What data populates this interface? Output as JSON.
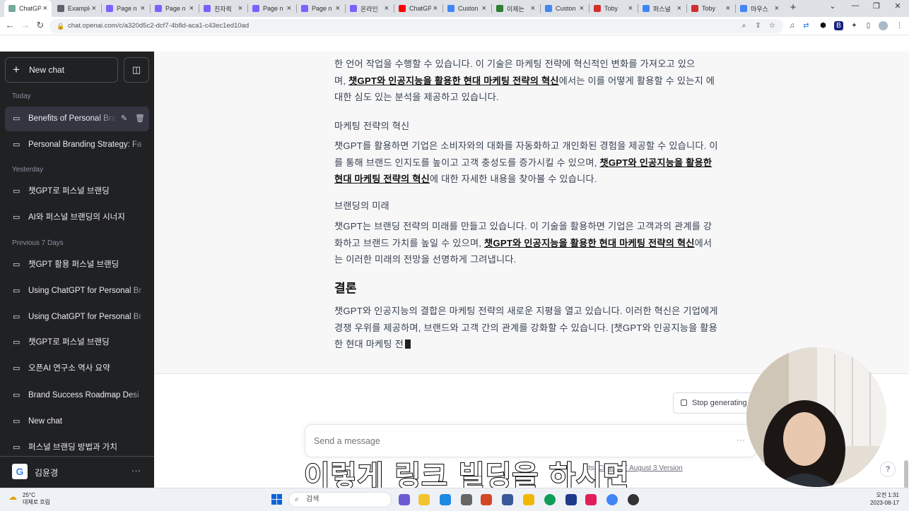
{
  "browser": {
    "tabs": [
      {
        "title": "ChatGPT",
        "color": "#74aa9c",
        "active": true
      },
      {
        "title": "Example",
        "color": "#5f6368"
      },
      {
        "title": "Page n",
        "color": "#7b61ff"
      },
      {
        "title": "Page n",
        "color": "#7b61ff"
      },
      {
        "title": "친자퀵",
        "color": "#7b61ff"
      },
      {
        "title": "Page n",
        "color": "#7b61ff"
      },
      {
        "title": "Page n",
        "color": "#7b61ff"
      },
      {
        "title": "온라인",
        "color": "#7b61ff"
      },
      {
        "title": "ChatGP",
        "color": "#ff0000"
      },
      {
        "title": "Custon",
        "color": "#4285f4"
      },
      {
        "title": "이제는",
        "color": "#2e7d32"
      },
      {
        "title": "Custon",
        "color": "#4285f4"
      },
      {
        "title": "Toby",
        "color": "#d32f2f"
      },
      {
        "title": "퍼스널",
        "color": "#4285f4"
      },
      {
        "title": "Toby",
        "color": "#d32f2f"
      },
      {
        "title": "마우스",
        "color": "#4285f4"
      }
    ],
    "new_tab_icon": "+",
    "url": "chat.openai.com/c/a320d5c2-dcf7-4b8d-aca1-c43ec1ed10ad"
  },
  "sidebar": {
    "new_chat_label": "New chat",
    "sections": {
      "today": "Today",
      "yesterday": "Yesterday",
      "previous7": "Previous 7 Days"
    },
    "items": [
      {
        "label": "Benefits of Personal Bra"
      },
      {
        "label": "Personal Branding Strategy: Fa"
      },
      {
        "label": "챗GPT로 퍼스널 브랜딩"
      },
      {
        "label": "AI와 퍼스널 브랜딩의 시너지"
      },
      {
        "label": "챗GPT 활용 퍼스널 브랜딩"
      },
      {
        "label": "Using ChatGPT for Personal Br"
      },
      {
        "label": "Using ChatGPT for Personal Br"
      },
      {
        "label": "챗GPT로 퍼스널 브랜딩"
      },
      {
        "label": "오픈AI 연구소 역사 요약"
      },
      {
        "label": "Brand Success Roadmap Desi"
      },
      {
        "label": "New chat"
      },
      {
        "label": "퍼스널 브랜딩 방법과 가치"
      }
    ],
    "user_name": "김윤경",
    "user_avatar": "G"
  },
  "message": {
    "p0_line0": "한 언어 작업을 수행할 수 있습니다. 이 기술은 마케팅 전략에 혁신적인 변화를 가져오고 있으",
    "p0_pre": "며, ",
    "link": "챗GPT와 인공지능을 활용한 현대 마케팅 전략의 혁신",
    "p0_post": "에서는 이를 어떻게 활용할 수 있는지 에 대한 심도 있는 분석을 제공하고 있습니다.",
    "h_marketing": "마케팅 전략의 혁신",
    "p1_pre": "챗GPT를 활용하면 기업은 소비자와의 대화를 자동화하고 개인화된 경험을 제공할 수 있습니다. 이를 통해 브랜드 인지도를 높이고 고객 충성도를 증가시킬 수 있으며, ",
    "p1_post": "에 대한 자세한 내용을 찾아볼 수 있습니다.",
    "h_future": "브랜딩의 미래",
    "p2_pre": "챗GPT는 브랜딩 전략의 미래를 만들고 있습니다. 이 기술을 활용하면 기업은 고객과의 관계를 강화하고 브랜드 가치를 높일 수 있으며, ",
    "p2_post": "에서는 이러한 미래의 전망을 선명하게 그려냅니다.",
    "h_conclusion": "결론",
    "p3": "챗GPT와 인공지능의 결합은 마케팅 전략의 새로운 지평을 열고 있습니다. 이러한 혁신은 기업에게 경쟁 우위를 제공하며, 브랜드와 고객 간의 관계를 강화할 수 있습니다. [챗GPT와 인공지능을 활용한 현대 마케팅 전"
  },
  "stop_button_label": "Stop generating",
  "input": {
    "placeholder": "Send a message"
  },
  "footer": {
    "prefix": "cts. ",
    "version_link": "ChatGPT August 3 Version"
  },
  "help_label": "?",
  "subtitle": "이렇게 링크 빌딩을 하시면",
  "taskbar": {
    "temp": "25°C",
    "weather": "대체로 흐림",
    "search_placeholder": "검색",
    "time": "오전 1:31",
    "date": "2023-08-17"
  }
}
